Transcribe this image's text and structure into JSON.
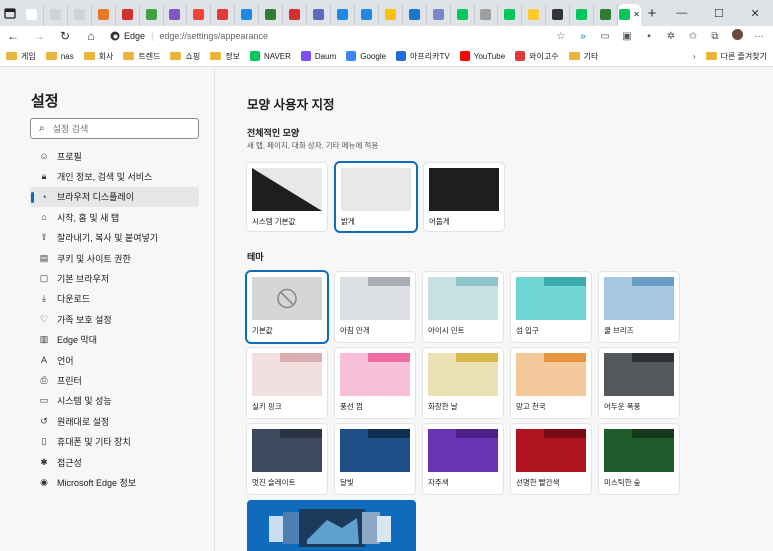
{
  "browser": {
    "address": {
      "site": "Edge",
      "path": "edge://settings/appearance"
    },
    "tab_favicons": [
      "#ffffff",
      "#cfd3d8",
      "#cfd3d8",
      "#e8782a",
      "#d32f2f",
      "#43a047",
      "#7e57c2",
      "#f44336",
      "#e53935",
      "#1e88e5",
      "#2e7d32",
      "#d32f2f",
      "#5c6bc0",
      "#1e88e5",
      "#1e88e5",
      "#ffc107",
      "#1976d2",
      "#7986cb",
      "#03c75a",
      "#9e9e9e",
      "#03c75a",
      "#ffca28",
      "#333333",
      "#03c75a",
      "#2e7d32",
      "#03c75a"
    ],
    "new_tab_label": "+",
    "window_controls": {
      "minimize": "—",
      "maximize": "☐",
      "close": "✕"
    },
    "bookmarks": [
      {
        "label": "게임",
        "type": "folder"
      },
      {
        "label": "nas",
        "type": "folder"
      },
      {
        "label": "회사",
        "type": "folder"
      },
      {
        "label": "트렌드",
        "type": "folder"
      },
      {
        "label": "쇼핑",
        "type": "folder"
      },
      {
        "label": "정보",
        "type": "folder"
      },
      {
        "label": "NAVER",
        "type": "link",
        "color": "#03c75a"
      },
      {
        "label": "Daum",
        "type": "link",
        "color": "#7c4dff"
      },
      {
        "label": "Google",
        "type": "link",
        "color": "#4285f4"
      },
      {
        "label": "아프리카TV",
        "type": "link",
        "color": "#1e6fd9"
      },
      {
        "label": "YouTube",
        "type": "link",
        "color": "#ff0000"
      },
      {
        "label": "와이고수",
        "type": "link",
        "color": "#e53935"
      },
      {
        "label": "기타",
        "type": "folder"
      }
    ],
    "other_bookmarks": "다른 즐겨찾기"
  },
  "sidebar": {
    "title": "설정",
    "search_placeholder": "설정 검색",
    "items": [
      {
        "label": "프로필",
        "icon": "profile-icon"
      },
      {
        "label": "개인 정보, 검색 및 서비스",
        "icon": "lock-icon"
      },
      {
        "label": "브라우저 디스플레이",
        "icon": "appearance-icon",
        "selected": true
      },
      {
        "label": "시작, 홈 및 새 탭",
        "icon": "home-icon"
      },
      {
        "label": "잘라내기, 복사 및 붙여넣기",
        "icon": "share-icon"
      },
      {
        "label": "쿠키 및 사이트 권한",
        "icon": "cookie-icon"
      },
      {
        "label": "기본 브라우저",
        "icon": "browser-icon"
      },
      {
        "label": "다운로드",
        "icon": "download-icon"
      },
      {
        "label": "가족 보호 설정",
        "icon": "family-icon"
      },
      {
        "label": "Edge 막대",
        "icon": "edge-bar-icon"
      },
      {
        "label": "언어",
        "icon": "language-icon"
      },
      {
        "label": "프린터",
        "icon": "printer-icon"
      },
      {
        "label": "시스템 및 성능",
        "icon": "system-icon"
      },
      {
        "label": "원래대로 설정",
        "icon": "reset-icon"
      },
      {
        "label": "휴대폰 및 기타 장치",
        "icon": "phone-icon"
      },
      {
        "label": "접근성",
        "icon": "accessibility-icon"
      },
      {
        "label": "Microsoft Edge 정보",
        "icon": "edge-logo-icon"
      }
    ]
  },
  "main": {
    "title": "모양 사용자 지정",
    "overall": {
      "heading": "전체적인 모양",
      "subtitle": "새 탭, 페이지, 대화 상자, 기타 메뉴에 적용",
      "options": [
        {
          "label": "시스템 기본값"
        },
        {
          "label": "밝게",
          "selected": true
        },
        {
          "label": "어둡게"
        }
      ]
    },
    "theme": {
      "heading": "테마",
      "items": [
        {
          "label": "기본값",
          "selected": true,
          "tab": "#e0e0e0",
          "bar": "#e0e0e0",
          "body": "#d6d6d6"
        },
        {
          "label": "아침 안개",
          "tab": "#dcdfe3",
          "bar": "#a9adb4",
          "body": "#dcdfe3"
        },
        {
          "label": "아이시 민트",
          "tab": "#c8e0e4",
          "bar": "#8fc3cb",
          "body": "#c8e0e4"
        },
        {
          "label": "섬 입구",
          "tab": "#70d6d4",
          "bar": "#3aaca9",
          "body": "#70d6d4"
        },
        {
          "label": "쿨 브리즈",
          "tab": "#a7c8e1",
          "bar": "#6a9ec4",
          "body": "#a7c8e1"
        },
        {
          "label": "실키 핑크",
          "tab": "#f2e0e0",
          "bar": "#d8aeae",
          "body": "#f2e0e0"
        },
        {
          "label": "풍선 껌",
          "tab": "#f7bfd8",
          "bar": "#ee6ea4",
          "body": "#f7bfd8"
        },
        {
          "label": "화창한 날",
          "tab": "#ece1b5",
          "bar": "#d6b84a",
          "body": "#ece1b5"
        },
        {
          "label": "망고 천국",
          "tab": "#f3c99b",
          "bar": "#e89540",
          "body": "#f3c99b"
        },
        {
          "label": "어두운 폭풍",
          "tab": "#54575c",
          "bar": "#2e3034",
          "body": "#54575c"
        },
        {
          "label": "멋진 슬레이트",
          "tab": "#3d4a5e",
          "bar": "#2a3444",
          "body": "#3d4a5e"
        },
        {
          "label": "달빛",
          "tab": "#1f4e86",
          "bar": "#112c52",
          "body": "#1f4e86"
        },
        {
          "label": "자주색",
          "tab": "#6a33b5",
          "bar": "#4a1f86",
          "body": "#6a33b5"
        },
        {
          "label": "선명한 빨간색",
          "tab": "#b0141e",
          "bar": "#7a0c13",
          "body": "#b0141e"
        },
        {
          "label": "미스틱한 숲",
          "tab": "#1f5c2c",
          "bar": "#123a1b",
          "body": "#1f5c2c"
        }
      ]
    }
  },
  "colors": {
    "accent": "#0f6cbd"
  }
}
